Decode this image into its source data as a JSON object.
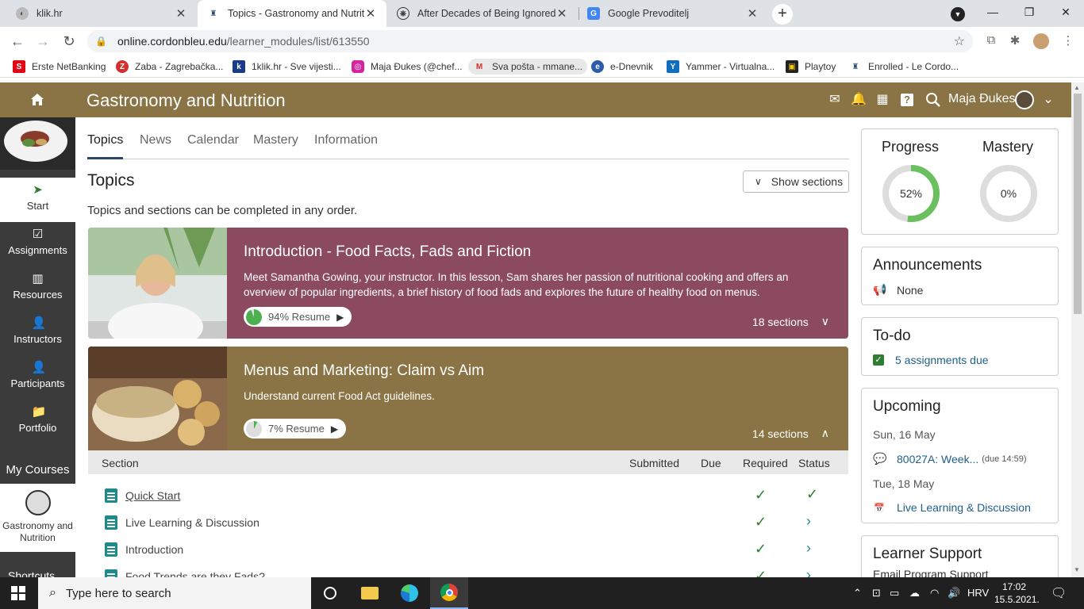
{
  "browser": {
    "tabs": [
      {
        "title": "klik.hr",
        "active": false
      },
      {
        "title": "Topics - Gastronomy and Nutrition",
        "active": true
      },
      {
        "title": "After Decades of Being Ignored, ...",
        "active": false
      },
      {
        "title": "Google Prevoditelj",
        "active": false
      }
    ],
    "url_host": "online.cordonbleu.edu",
    "url_path": "/learner_modules/list/613550",
    "bookmarks": [
      "Erste NetBanking",
      "Zaba - Zagrebačka...",
      "1klik.hr - Sve vijesti...",
      "Maja Đukes (@chef...",
      "Sva pošta - mmane...",
      "e-Dnevnik",
      "Yammer - Virtualna...",
      "Playtoy",
      "Enrolled - Le Cordo..."
    ]
  },
  "header": {
    "title": "Gastronomy and Nutrition",
    "username": "Maja Đukes"
  },
  "sidebar": {
    "items": [
      "Start",
      "Assignments",
      "Resources",
      "Instructors",
      "Participants",
      "Portfolio"
    ],
    "my_courses_title": "My Courses",
    "my_course_name": "Gastronomy and Nutrition",
    "shortcuts_label": "Shortcuts"
  },
  "main": {
    "tabs": [
      "Topics",
      "News",
      "Calendar",
      "Mastery",
      "Information"
    ],
    "heading": "Topics",
    "show_sections": "Show sections",
    "subtitle": "Topics and sections can be completed in any order.",
    "topics": [
      {
        "title": "Introduction - Food Facts, Fads and Fiction",
        "description": "Meet Samantha Gowing, your instructor. In this lesson, Sam shares her passion of nutritional cooking and offers an overview of popular ingredients, a brief history of food fads and explores the future of healthy food on menus.",
        "progress_label": "94%",
        "progress": 94,
        "resume": "Resume",
        "sections": "18 sections",
        "color": "#8c4a60"
      },
      {
        "title": "Menus and Marketing: Claim vs Aim",
        "description": "Understand current Food Act guidelines.",
        "progress_label": "7%",
        "progress": 7,
        "resume": "Resume",
        "sections": "14 sections",
        "color": "#8a7445"
      }
    ],
    "section_table": {
      "headers": [
        "Section",
        "Submitted",
        "Due",
        "Required",
        "Status"
      ],
      "rows": [
        {
          "name": "Quick Start",
          "status": "done"
        },
        {
          "name": "Live Learning & Discussion",
          "status": "open"
        },
        {
          "name": "Introduction",
          "status": "open"
        },
        {
          "name": "Food Trends are they Fads?",
          "status": "open"
        }
      ]
    }
  },
  "right": {
    "progress_title": "Progress",
    "progress_value": "52%",
    "progress_pct": 52,
    "mastery_title": "Mastery",
    "mastery_value": "0%",
    "mastery_pct": 0,
    "announcements_title": "Announcements",
    "announcements_value": "None",
    "todo_title": "To-do",
    "todo_value": "5 assignments due",
    "upcoming_title": "Upcoming",
    "upcoming": [
      {
        "date": "Sun, 16 May",
        "item": "80027A: Week...",
        "due": "(due 14:59)"
      },
      {
        "date": "Tue, 18 May",
        "item": "Live Learning & Discussion",
        "due": ""
      }
    ],
    "support_title": "Learner Support",
    "support_item": "Email Program Support"
  },
  "taskbar": {
    "search_placeholder": "Type here to search",
    "language": "HRV",
    "time": "17:02",
    "date": "15.5.2021."
  },
  "colors": {
    "brand": "#8a7445",
    "topic1": "#8c4a60",
    "success": "#2e7d32",
    "teal": "#1e8a8a",
    "ring_fill": "#6abf5e"
  }
}
